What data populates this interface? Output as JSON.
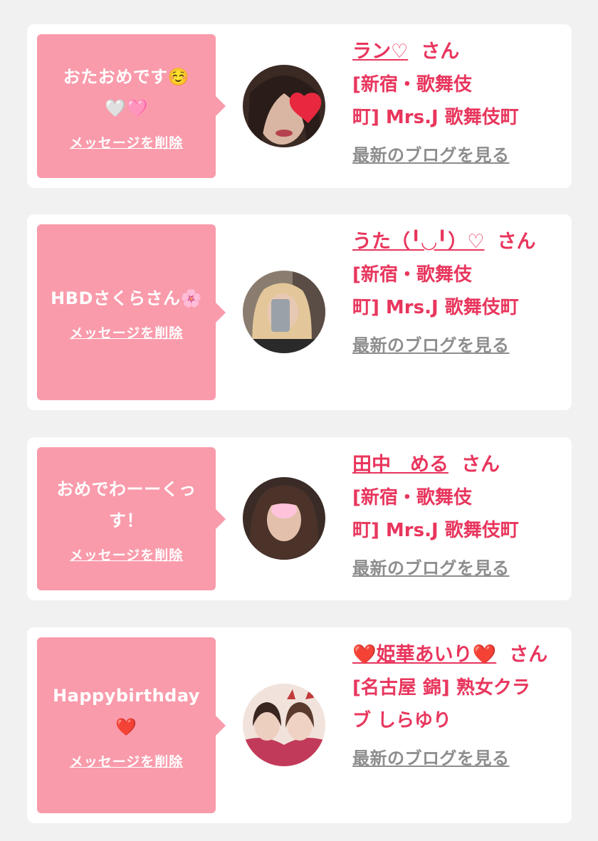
{
  "delete_label": "メッセージを削除",
  "blog_label": "最新のブログを見る",
  "san_suffix": "さん",
  "colors": {
    "accent": "#e8365d",
    "bubble": "#f99bab",
    "link_gray": "#8d8d8d",
    "background": "#f1f1f1"
  },
  "cards": [
    {
      "message_line1": "おたおめです☺️",
      "message_line2": "🤍🩷",
      "name": "ラン♡",
      "shop_line1": "[新宿・歌舞伎",
      "shop_line2": "町] Mrs.J 歌舞伎町"
    },
    {
      "message_line1": "HBDさくらさん🌸",
      "name": "うた（╹◡╹）♡",
      "shop_line1": "[新宿・歌舞伎",
      "shop_line2": "町] Mrs.J 歌舞伎町"
    },
    {
      "message_line1": "おめでわーーくっ",
      "message_line2": "す！",
      "name": "田中　める",
      "shop_line1": "[新宿・歌舞伎",
      "shop_line2": "町] Mrs.J 歌舞伎町"
    },
    {
      "message_line1": "Happybirthday❤️",
      "name": "❤️姫華あいり❤️",
      "shop_line1": "[名古屋 錦] 熟女クラ",
      "shop_line2": "ブ しらゆり"
    }
  ]
}
